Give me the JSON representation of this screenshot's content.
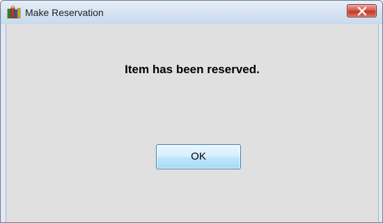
{
  "window": {
    "title": "Make Reservation",
    "app_icon": "reservation-books-icon",
    "close_icon": "close-icon"
  },
  "dialog": {
    "message": "Item has been reserved.",
    "ok_label": "OK"
  },
  "colors": {
    "titlebar": "#d7e4f2",
    "client_background": "#e0e0e0",
    "close_button": "#c13a2b",
    "ok_button": "#bee6fd"
  }
}
